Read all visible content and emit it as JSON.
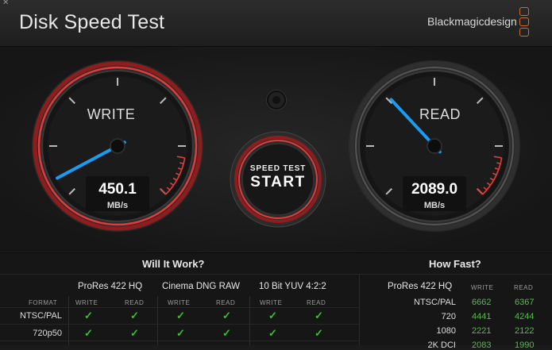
{
  "window": {
    "close_glyph": "✕",
    "title": "Disk Speed Test",
    "brand": "Blackmagicdesign"
  },
  "gauges": {
    "write": {
      "label": "WRITE",
      "value": "450.1",
      "unit": "MB/s"
    },
    "read": {
      "label": "READ",
      "value": "2089.0",
      "unit": "MB/s"
    }
  },
  "start_button": {
    "small_label": "SPEED TEST",
    "big_label": "START"
  },
  "will_it_work": {
    "title": "Will It Work?",
    "format_label": "FORMAT",
    "formats": [
      "ProRes 422 HQ",
      "Cinema DNG RAW",
      "10 Bit YUV 4:2:2"
    ],
    "sub_labels": [
      "WRITE",
      "READ"
    ],
    "rows": [
      {
        "label": "NTSC/PAL",
        "checks": [
          "✓",
          "✓",
          "✓",
          "✓",
          "✓",
          "✓"
        ]
      },
      {
        "label": "720p50",
        "checks": [
          "✓",
          "✓",
          "✓",
          "✓",
          "✓",
          "✓"
        ]
      }
    ]
  },
  "how_fast": {
    "title": "How Fast?",
    "format": "ProRes 422 HQ",
    "sub_labels": [
      "WRITE",
      "READ"
    ],
    "rows": [
      {
        "label": "NTSC/PAL",
        "write": "6662",
        "read": "6367"
      },
      {
        "label": "720",
        "write": "4441",
        "read": "4244"
      },
      {
        "label": "1080",
        "write": "2221",
        "read": "2122"
      },
      {
        "label": "2K DCI",
        "write": "2083",
        "read": "1990"
      }
    ]
  },
  "colors": {
    "accent_blue": "#1a9cf0",
    "redline": "#d12a2a",
    "check_green": "#3fbf34",
    "logo_orange": "#d36a2e"
  },
  "icons": {
    "start": "start-ring-icon",
    "settings": "settings-knob-icon",
    "check": "checkmark-icon"
  }
}
